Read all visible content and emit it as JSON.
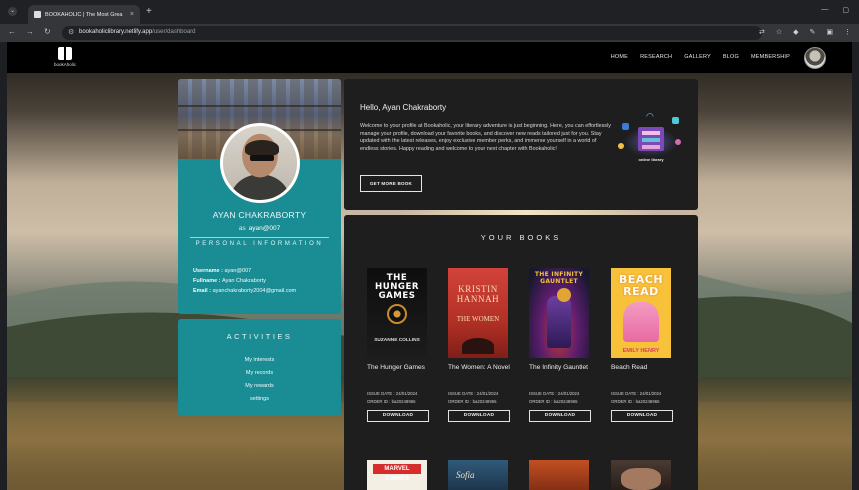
{
  "browser": {
    "tab_title": "BOOKAHOLIC | The Most Grea",
    "tab_close": "×",
    "new_tab": "+",
    "url_domain": "bookaholiclibrary.netlify.app",
    "url_path": "/user/dashboard",
    "nav_icons": [
      "arrow-left-icon",
      "arrow-right-icon",
      "reload-icon"
    ],
    "window_controls": [
      "minimize-icon",
      "maximize-icon"
    ]
  },
  "site": {
    "logo_text": "bookAholic",
    "nav": [
      "HOME",
      "RESEARCH",
      "GALLERY",
      "BLOG",
      "MEMBERSHIP"
    ]
  },
  "profile": {
    "name": "AYAN CHAKRABORTY",
    "as_label": "as",
    "username_handle": "ayan@007",
    "section_title": "PERSONAL INFORMATION",
    "info": [
      {
        "label": "Username : ",
        "value": "ayan@007"
      },
      {
        "label": "Fullname : ",
        "value": "Ayan Chakraborty"
      },
      {
        "label": "Email : ",
        "value": "ayanchakraborty2004@gmail.com"
      }
    ]
  },
  "activities": {
    "title": "ACTIVITIES",
    "items": [
      "My interests",
      "My records",
      "My rewards",
      "settings"
    ]
  },
  "welcome": {
    "greeting": "Hello, Ayan Chakraborty",
    "message": "Welcome to your profile at Bookaholic, your literary adventure is just beginning. Here, you can effortlessly manage your profile, download your favorite books, and discover new reads tailored just for you. Stay updated with the latest releases, enjoy exclusive member perks, and immerse yourself in a world of endless stories. Happy reading and welcome to your next chapter with Bookaholic!",
    "button": "GET MORE BOOK",
    "illustration_caption": "online library"
  },
  "books": {
    "title": "YOUR BOOKS",
    "download_label": "DOWNLOAD",
    "items": [
      {
        "title": "The Hunger Games",
        "issue": "ISSUE DATE : 24/01/2024",
        "order": "ORDER ID : ba20248965",
        "cover_title": "THE HUNGER GAMES",
        "cover_author": "SUZANNE COLLINS"
      },
      {
        "title": "The Women: A Novel",
        "issue": "ISSUE DATE : 24/01/2024",
        "order": "ORDER ID : ba20248965",
        "cover_author": "KRISTIN HANNAH",
        "cover_title": "THE WOMEN"
      },
      {
        "title": "The Infinity Gauntlet",
        "issue": "ISSUE DATE : 24/01/2024",
        "order": "ORDER ID : ba20248965",
        "cover_title": "THE INFINITY GAUNTLET"
      },
      {
        "title": "Beach Read",
        "issue": "ISSUE DATE : 24/01/2024",
        "order": "ORDER ID : ba20248965",
        "cover_title": "BEACH READ",
        "cover_author": "EMILY HENRY"
      }
    ],
    "peek_covers": [
      {
        "text": "MARVEL COMICS"
      },
      {
        "text": "Sofia"
      },
      {
        "text": ""
      },
      {
        "text": ""
      }
    ]
  },
  "colors": {
    "teal_card": "#1a8c93",
    "panel_dark": "#1e1e1e",
    "nav_black": "#000000"
  }
}
